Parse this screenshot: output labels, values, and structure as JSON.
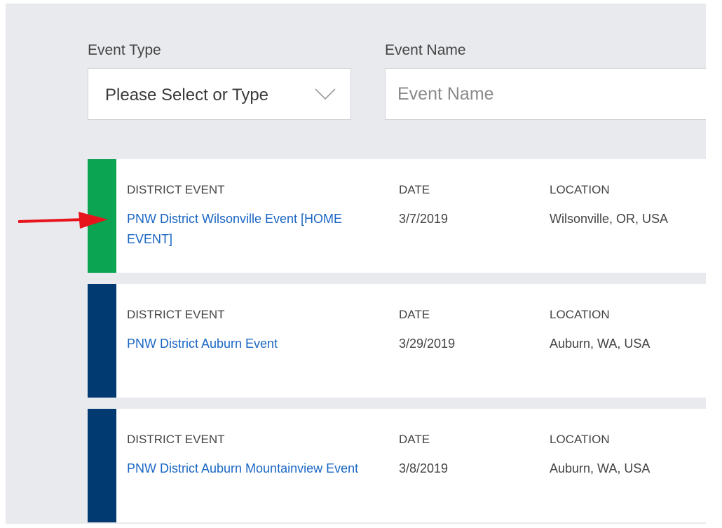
{
  "filters": {
    "event_type_label": "Event Type",
    "event_type_value": "Please Select or Type",
    "event_name_label": "Event Name",
    "event_name_placeholder": "Event Name"
  },
  "events": [
    {
      "type": "DISTRICT EVENT",
      "name": "PNW District Wilsonville Event [HOME EVENT]",
      "date_label": "DATE",
      "date": "3/7/2019",
      "location_label": "LOCATION",
      "location": "Wilsonville, OR, USA",
      "stripe_color": "#0aa452"
    },
    {
      "type": "DISTRICT EVENT",
      "name": "PNW District Auburn Event",
      "date_label": "DATE",
      "date": "3/29/2019",
      "location_label": "LOCATION",
      "location": "Auburn, WA, USA",
      "stripe_color": "#003a70"
    },
    {
      "type": "DISTRICT EVENT",
      "name": "PNW District Auburn Mountainview Event",
      "date_label": "DATE",
      "date": "3/8/2019",
      "location_label": "LOCATION",
      "location": "Auburn, WA, USA",
      "stripe_color": "#003a70"
    }
  ],
  "annotation": {
    "arrow_color": "#e8141c"
  }
}
